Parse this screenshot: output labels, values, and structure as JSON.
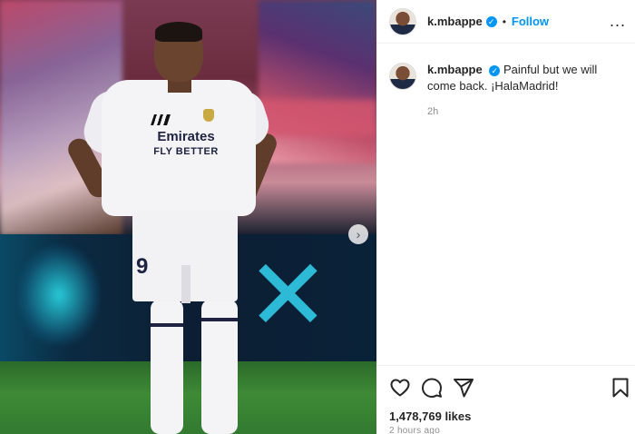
{
  "post": {
    "username": "k.mbappe",
    "verified": true,
    "follow_label": "Follow",
    "separator": "•",
    "more_label": "...",
    "caption": "Painful but we will come back. ¡HalaMadrid!",
    "caption_time": "2h",
    "likes": "1,478,769 likes",
    "posted_ago": "2 hours ago"
  },
  "photo": {
    "jersey_sponsor": "Emirates",
    "jersey_sponsor_sub": "FLY BETTER",
    "jersey_number": "9"
  },
  "icons": {
    "like": "heart-icon",
    "comment": "comment-icon",
    "share": "send-icon",
    "save": "bookmark-icon",
    "next": "chevron-right-icon",
    "verified": "verified-badge-icon",
    "more": "more-options-icon"
  },
  "colors": {
    "accent": "#0095f6",
    "text": "#262626",
    "muted": "#8e8e8e"
  }
}
